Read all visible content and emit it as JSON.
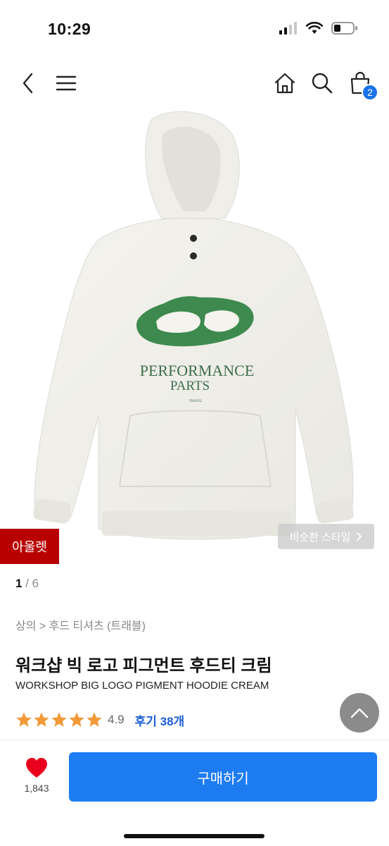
{
  "status": {
    "time": "10:29"
  },
  "nav": {
    "cart_count": "2",
    "icons": [
      "back-icon",
      "menu-icon",
      "home-icon",
      "search-icon",
      "cart-icon"
    ]
  },
  "product": {
    "image_print_line1": "PERFORMANCE",
    "image_print_line2": "PARTS",
    "image_print_small": "TRAVEL",
    "outlet_label": "아울렛",
    "similar_style_label": "비슷한 스타일",
    "pager_current": "1",
    "pager_total": "6",
    "breadcrumb": "상의 > 후드 티셔츠 (트래블)",
    "title_ko": "워크샵 빅 로고 피그먼트 후드티 크림",
    "title_en": "WORKSHOP BIG LOGO PIGMENT HOODIE CREAM",
    "rating": "4.9",
    "stars_filled": 5,
    "review_label": "후기 38개"
  },
  "bottom": {
    "like_count": "1,843",
    "buy_label": "구매하기"
  },
  "colors": {
    "accent": "#1e7cf2",
    "outlet_red": "#b80000",
    "star": "#f29a38",
    "heart": "#e8001c",
    "logo_green": "#3e8a4e"
  }
}
